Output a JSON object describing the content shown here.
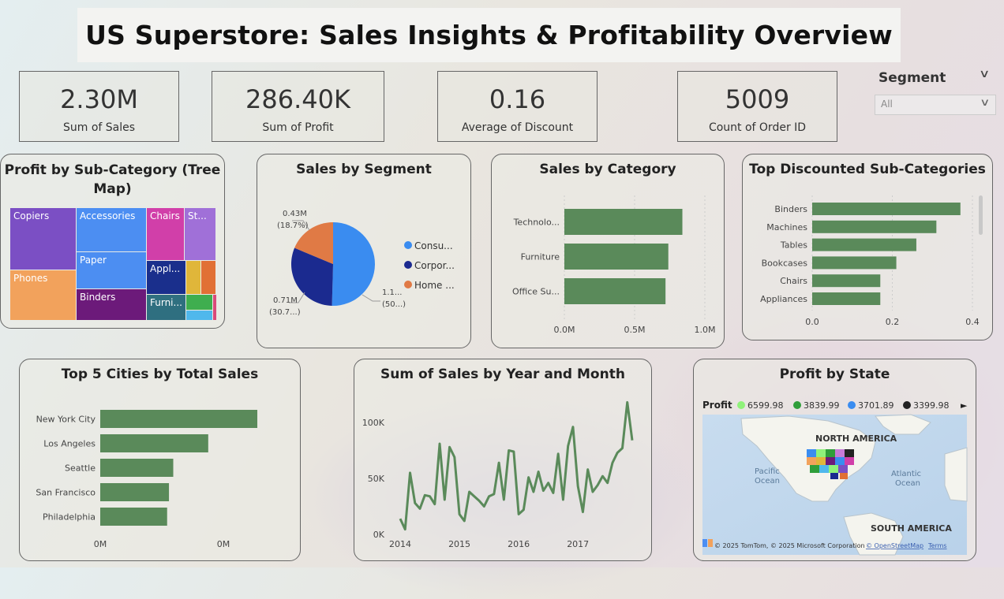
{
  "title": "US Superstore: Sales Insights & Profitability Overview",
  "kpis": [
    {
      "value": "2.30M",
      "label": "Sum of Sales"
    },
    {
      "value": "286.40K",
      "label": "Sum of Profit"
    },
    {
      "value": "0.16",
      "label": "Average of Discount"
    },
    {
      "value": "5009",
      "label": "Count of Order ID"
    }
  ],
  "slicer": {
    "label": "Segment",
    "selected": "All"
  },
  "treemap": {
    "title": "Profit by Sub-Category (Tree Map)",
    "items": [
      {
        "label": "Copiers",
        "color": "#7b4fc4"
      },
      {
        "label": "Phones",
        "color": "#f2a25c"
      },
      {
        "label": "Accessories",
        "color": "#4c8ef2"
      },
      {
        "label": "Paper",
        "color": "#4c8ef2"
      },
      {
        "label": "Binders",
        "color": "#6c1a7a"
      },
      {
        "label": "Chairs",
        "color": "#d13fa9"
      },
      {
        "label": "St...",
        "color": "#a070d8"
      },
      {
        "label": "Appl...",
        "color": "#1a2f8c"
      },
      {
        "label": "Furni...",
        "color": "#2f6f80"
      },
      {
        "label": "",
        "color": "#e0b63a"
      },
      {
        "label": "",
        "color": "#e17035"
      },
      {
        "label": "",
        "color": "#3fae4f"
      },
      {
        "label": "",
        "color": "#4fb8ec"
      },
      {
        "label": "",
        "color": "#d94a7a"
      }
    ]
  },
  "segment_pie": {
    "title": "Sales by Segment",
    "legend": [
      "Consu...",
      "Corpor...",
      "Home ..."
    ],
    "labels": [
      {
        "line1": "1.1...",
        "line2": "(50...)"
      },
      {
        "line1": "0.71M",
        "line2": "(30.7...)"
      },
      {
        "line1": "0.43M",
        "line2": "(18.7%)"
      }
    ]
  },
  "category_bar": {
    "title": "Sales by Category",
    "ticks": [
      "0.0M",
      "0.5M",
      "1.0M"
    ]
  },
  "discount_bar": {
    "title": "Top Discounted Sub-Categories",
    "ticks": [
      "0.0",
      "0.2",
      "0.4"
    ]
  },
  "cities_bar": {
    "title": "Top 5 Cities by Total Sales",
    "ticks": [
      "0M",
      "0M"
    ]
  },
  "line_chart": {
    "title": "Sum of Sales by Year and Month",
    "yticks": [
      "100K",
      "50K",
      "0K"
    ],
    "xticks": [
      "2014",
      "2015",
      "2016",
      "2017"
    ]
  },
  "map": {
    "title": "Profit by State",
    "legend_title": "Profit",
    "legend": [
      {
        "value": "6599.98",
        "color": "#8ff27a"
      },
      {
        "value": "3839.99",
        "color": "#2f9e3a"
      },
      {
        "value": "3701.89",
        "color": "#3a8cf0"
      },
      {
        "value": "3399.98",
        "color": "#222222"
      }
    ],
    "labels": {
      "north_america": "NORTH AMERICA",
      "south_america": "SOUTH AMERICA",
      "pacific_1": "Pacific",
      "pacific_2": "Ocean",
      "atlantic_1": "Atlantic",
      "atlantic_2": "Ocean"
    },
    "attribution": "© 2025 TomTom, © 2025 Microsoft Corporation",
    "osm": "© OpenStreetMap",
    "terms": "Terms"
  },
  "chart_data": [
    {
      "type": "pie",
      "title": "Sales by Segment",
      "categories": [
        "Consu...",
        "Corpor...",
        "Home ..."
      ],
      "values": [
        1.16,
        0.71,
        0.43
      ],
      "percents": [
        50.6,
        30.7,
        18.7
      ],
      "colors": [
        "#3a8cf0",
        "#1b2a8f",
        "#e07a45"
      ]
    },
    {
      "type": "bar",
      "title": "Sales by Category",
      "orientation": "horizontal",
      "categories": [
        "Technolo...",
        "Furniture",
        "Office Su..."
      ],
      "values": [
        0.84,
        0.74,
        0.72
      ],
      "xlim": [
        0,
        1.0
      ],
      "color": "#5a8a5a"
    },
    {
      "type": "bar",
      "title": "Top Discounted Sub-Categories",
      "orientation": "horizontal",
      "categories": [
        "Binders",
        "Machines",
        "Tables",
        "Bookcases",
        "Chairs",
        "Appliances"
      ],
      "values": [
        0.37,
        0.31,
        0.26,
        0.21,
        0.17,
        0.17
      ],
      "xlim": [
        0,
        0.4
      ],
      "color": "#5a8a5a"
    },
    {
      "type": "bar",
      "title": "Top 5 Cities by Total Sales",
      "orientation": "horizontal",
      "categories": [
        "New York City",
        "Los Angeles",
        "Seattle",
        "San Francisco",
        "Philadelphia"
      ],
      "values": [
        256000,
        176000,
        119000,
        112000,
        109000
      ],
      "color": "#5a8a5a"
    },
    {
      "type": "line",
      "title": "Sum of Sales by Year and Month",
      "ylim": [
        0,
        110000
      ],
      "x_start": "2014-01",
      "values": [
        14000,
        4500,
        55000,
        28000,
        23000,
        35000,
        34000,
        27000,
        81000,
        31000,
        78000,
        69000,
        18000,
        12000,
        38000,
        34000,
        30000,
        25000,
        34000,
        36000,
        64000,
        31000,
        75000,
        74000,
        18000,
        22000,
        51000,
        38000,
        56000,
        39000,
        46000,
        37000,
        72000,
        31000,
        79000,
        96000,
        43000,
        20000,
        58000,
        38000,
        44000,
        52000,
        46000,
        64000,
        73000,
        77000,
        118000,
        84000
      ],
      "color": "#5a8a5a"
    }
  ]
}
